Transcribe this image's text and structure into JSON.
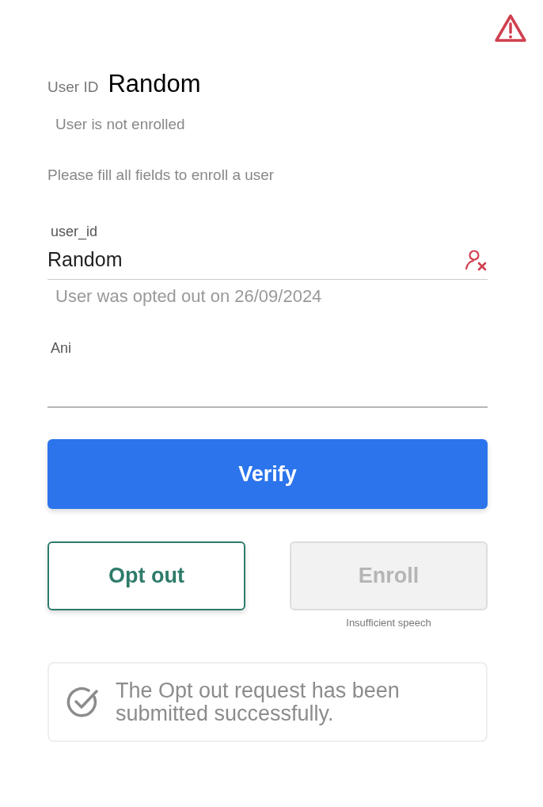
{
  "header": {
    "user_id_label": "User ID",
    "user_id": "Random",
    "status": "User is not enrolled"
  },
  "instruction": "Please fill all fields to enroll a user",
  "fields": [
    {
      "label": "user_id",
      "value": "Random",
      "helper": "User was opted out on 26/09/2024",
      "kind": "clearable"
    },
    {
      "label": "Ani",
      "kind": "plain"
    }
  ],
  "verify_button": "Verify",
  "actions": [
    {
      "label": "Opt out",
      "disabled": false
    },
    {
      "label": "Enroll",
      "disabled": true,
      "hint": "Insufficient speech"
    }
  ],
  "notice": "The Opt out request has been submitted successfully."
}
